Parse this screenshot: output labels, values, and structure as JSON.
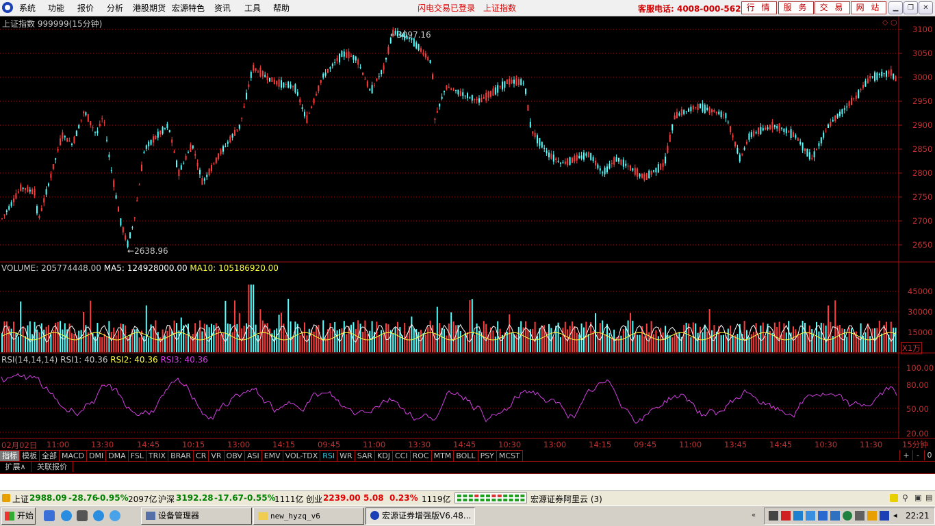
{
  "menubar": {
    "items": [
      "系统",
      "功能",
      "报价",
      "分析",
      "港股期货",
      "宏源特色",
      "资讯",
      "工具",
      "帮助"
    ],
    "status_login": "闪电交易已登录",
    "status_index": "上证指数",
    "service_phone": "客服电话: 4008-000-562",
    "buttons": [
      "行 情",
      "服 务",
      "交 易",
      "网 站"
    ]
  },
  "kline": {
    "title": "上证指数 999999(15分钟)",
    "high_label": "3097.16",
    "low_label": "2638.96",
    "y_ticks": [
      "3100",
      "3050",
      "3000",
      "2950",
      "2900",
      "2850",
      "2800",
      "2750",
      "2700",
      "2650"
    ]
  },
  "volume": {
    "label_prefix": "VOLUME: 205774448.00",
    "ma5": "MA5: 124928000.00",
    "ma10": "MA10: 105186920.00",
    "y_ticks": [
      "45000",
      "30000",
      "15000"
    ],
    "unit": "X1万"
  },
  "rsi": {
    "label": "RSI(14,14,14)",
    "rsi1": "RSI1: 40.36",
    "rsi2": "RSI2: 40.36",
    "rsi3": "RSI3: 40.36",
    "y_ticks": [
      "100.00",
      "80.00",
      "50.00",
      "20.00"
    ]
  },
  "x_axis": {
    "labels": [
      "02月02日",
      "11:00",
      "13:30",
      "14:45",
      "10:15",
      "13:00",
      "14:15",
      "09:45",
      "11:00",
      "13:30",
      "14:45",
      "10:30",
      "13:00",
      "14:15",
      "09:45",
      "11:00",
      "13:45",
      "14:45",
      "10:30",
      "11:30"
    ],
    "period": "15分钟"
  },
  "indicator_tabs": [
    "指标",
    "模板",
    "全部",
    "MACD",
    "DMI",
    "DMA",
    "FSL",
    "TRIX",
    "BRAR",
    "CR",
    "VR",
    "OBV",
    "ASI",
    "EMV",
    "VOL-TDX",
    "RSI",
    "WR",
    "SAR",
    "KDJ",
    "CCI",
    "ROC",
    "MTM",
    "BOLL",
    "PSY",
    "MCST"
  ],
  "tab_controls": [
    "+",
    "-",
    "0"
  ],
  "ext_tabs": [
    "扩展∧",
    "关联报价"
  ],
  "statusbar": {
    "sh_name": "上证",
    "sh_value": "2988.09",
    "sh_change": "-28.76",
    "sh_pct": "-0.95%",
    "sh_amount": "2097亿",
    "hs_name": "沪深",
    "hs_value": "3192.28",
    "hs_change": "-17.67",
    "hs_pct": "-0.55%",
    "hs_amount": "1111亿",
    "cy_name": "创业",
    "cy_value": "2239.00",
    "cy_change": "5.08",
    "cy_pct": "0.23%",
    "cy_amount": "1119亿",
    "server": "宏源证券阿里云 (3)"
  },
  "taskbar": {
    "start": "开始",
    "items": [
      "设备管理器",
      "new_hyzq_v6",
      "宏源证券增强版V6.48..."
    ],
    "clock": "22:21"
  },
  "colors": {
    "up": "#ff3c3c",
    "down": "#54ffff",
    "rsi": "#d040e0",
    "ma5": "#ffffff",
    "ma10": "#ffff40",
    "grid": "#a01010"
  }
}
